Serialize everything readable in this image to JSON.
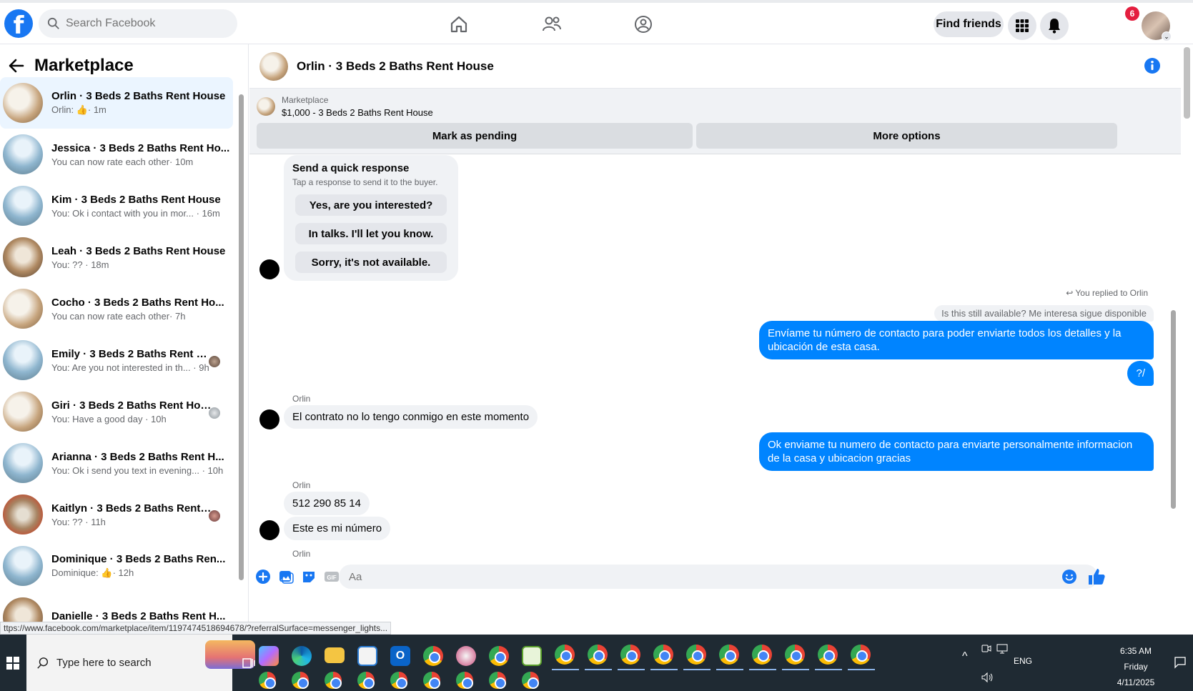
{
  "topbar": {
    "search_placeholder": "Search Facebook",
    "find_friends_label": "Find friends",
    "notification_count": "6"
  },
  "sidebar": {
    "title": "Marketplace",
    "conversations": [
      {
        "name": "Orlin · 3 Beds 2 Baths Rent House",
        "preview": "Orlin:",
        "time": "· 1m",
        "active": true
      },
      {
        "name": "Jessica · 3 Beds 2 Baths Rent Ho...",
        "preview": "You can now rate each other",
        "time": "· 10m"
      },
      {
        "name": "Kim · 3 Beds 2 Baths Rent House",
        "preview": "You: Ok i contact with you in mor...",
        "time": "· 16m"
      },
      {
        "name": "Leah · 3 Beds 2 Baths Rent House",
        "preview": "You: ??",
        "time": "· 18m"
      },
      {
        "name": "Cocho · 3 Beds 2 Baths Rent Ho...",
        "preview": "You can now rate each other",
        "time": "· 7h"
      },
      {
        "name": "Emily · 3 Beds 2 Baths Rent H...",
        "preview": "You: Are you not interested in th...",
        "time": "· 9h"
      },
      {
        "name": "Giri · 3 Beds 2 Baths Rent Hou...",
        "preview": "You: Have a good day",
        "time": "· 10h"
      },
      {
        "name": "Arianna · 3 Beds 2 Baths Rent H...",
        "preview": "You: Ok i send you text in evening...",
        "time": "· 10h"
      },
      {
        "name": "Kaitlyn · 3 Beds 2 Baths Rent ...",
        "preview": "You: ??",
        "time": "· 11h"
      },
      {
        "name": "Dominique · 3 Beds 2 Baths Ren...",
        "preview": "Dominique:",
        "time": "· 12h"
      },
      {
        "name": "Danielle · 3 Beds 2 Baths Rent H...",
        "preview": "",
        "time": ""
      }
    ]
  },
  "chat": {
    "title": "Orlin · 3 Beds 2 Baths Rent House",
    "listing_kicker": "Marketplace",
    "listing_price": "$1,000 - 3 Beds 2 Baths Rent House",
    "mark_pending_label": "Mark as pending",
    "more_options_label": "More options",
    "quick_response": {
      "title": "Send a quick response",
      "subtitle": "Tap a response to send it to the buyer.",
      "options": [
        "Yes, are you interested?",
        "In talks. I'll let you know.",
        "Sorry, it's not available."
      ]
    },
    "reply_note": "You replied to Orlin",
    "quoted_text": "Is this still available? Me interesa sigue disponible",
    "messages": {
      "out_1": "Envíame tu número de contacto para poder enviarte todos los detalles y la ubicación de esta casa.",
      "out_2": "?/",
      "sender_1": "Orlin",
      "in_1": "El contrato no lo tengo conmigo en este momento",
      "out_3": "Ok enviame tu numero de contacto para enviarte personalmente informacion de la casa y ubicacion gracias",
      "sender_2": "Orlin",
      "in_2": "512 290 85 14",
      "in_3": "Este es mi número",
      "sender_3": "Orlin"
    },
    "composer_placeholder": "Aa"
  },
  "status_url": "ttps://www.facebook.com/marketplace/item/1197474518694678/?referralSurface=messenger_lights...",
  "taskbar": {
    "search_placeholder": "Type here to search",
    "language": "ENG",
    "time": "6:35 AM",
    "day": "Friday",
    "date": "4/11/2025"
  },
  "colors": {
    "brand_blue": "#1877f2",
    "messenger_blue": "#0084ff",
    "badge_red": "#e41e3f"
  }
}
